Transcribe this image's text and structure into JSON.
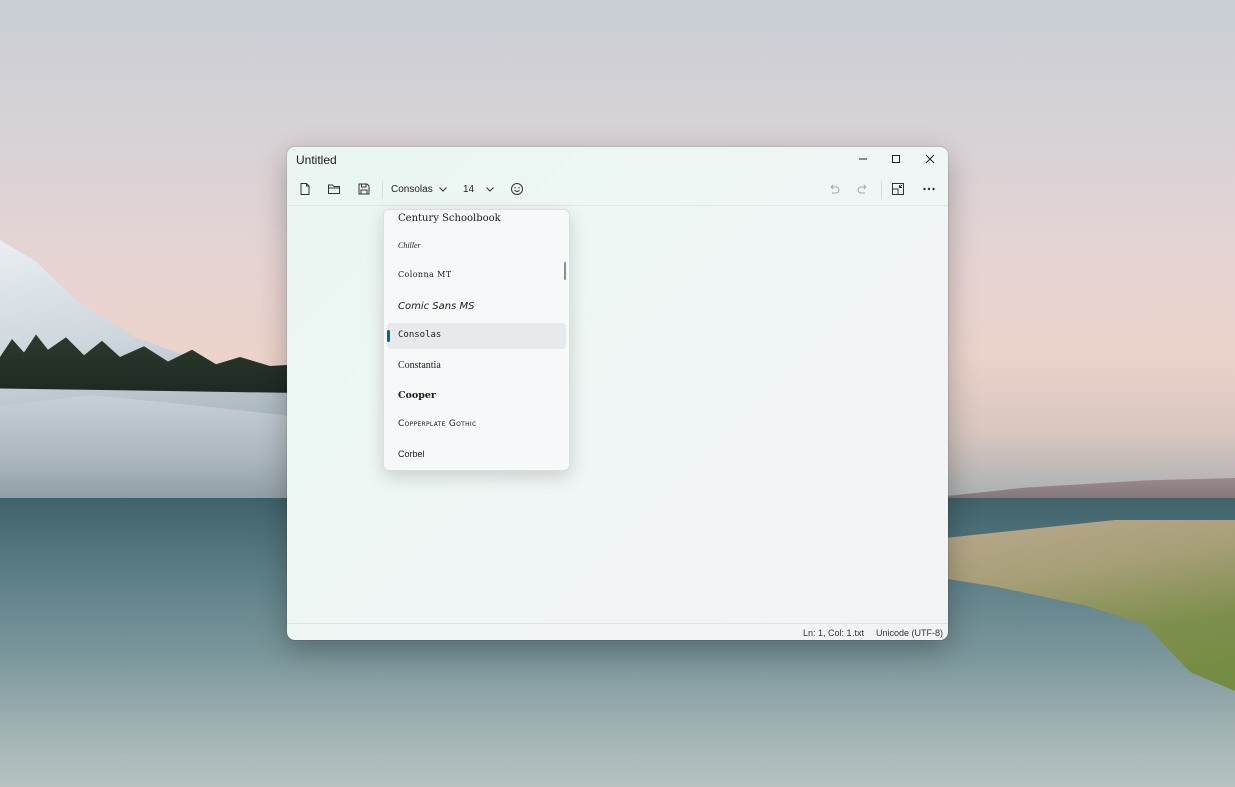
{
  "window": {
    "title": "Untitled",
    "controls": {
      "minimize": "—",
      "maximize": "▢",
      "close": "✕"
    }
  },
  "toolbar": {
    "font": "Consolas",
    "size": "14",
    "icons": [
      "new-file-icon",
      "open-folder-icon",
      "save-icon",
      "emoji-icon",
      "undo-icon",
      "redo-icon",
      "compact-overlay-icon",
      "more-icon"
    ]
  },
  "font_menu": {
    "items": [
      {
        "label": "Century Schoolbook"
      },
      {
        "label": "Chiller"
      },
      {
        "label": "Colonna MT"
      },
      {
        "label": "Comic Sans MS"
      },
      {
        "label": "Consolas",
        "selected": true
      },
      {
        "label": "Constantia"
      },
      {
        "label": "Cooper"
      },
      {
        "label": "Copperplate Gothic"
      },
      {
        "label": "Corbel"
      }
    ]
  },
  "status": {
    "position": "Ln: 1, Col: 1",
    "extension": ".txt",
    "encoding": "Unicode (UTF-8)"
  },
  "colors": {
    "accent": "#1e5b74"
  }
}
